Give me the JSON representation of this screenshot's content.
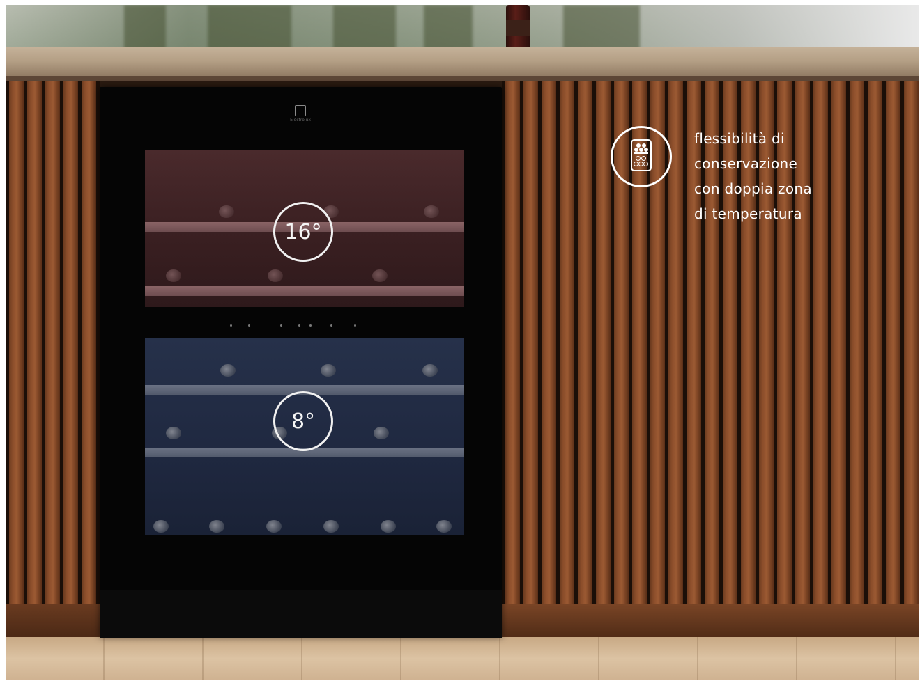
{
  "cooler": {
    "brand": "Electrolux",
    "zones": [
      {
        "id": "top",
        "temperature": "16°",
        "color": "#4a2a2c"
      },
      {
        "id": "bottom",
        "temperature": "8°",
        "color": "#26314a"
      }
    ]
  },
  "feature": {
    "icon": "dual-zone-wine-cooler-icon",
    "lines": [
      "flessibilità di",
      "conservazione",
      "con doppia zona",
      "di temperatura"
    ]
  },
  "colors": {
    "wood": "#8a4d2a",
    "text": "#ffffff"
  }
}
